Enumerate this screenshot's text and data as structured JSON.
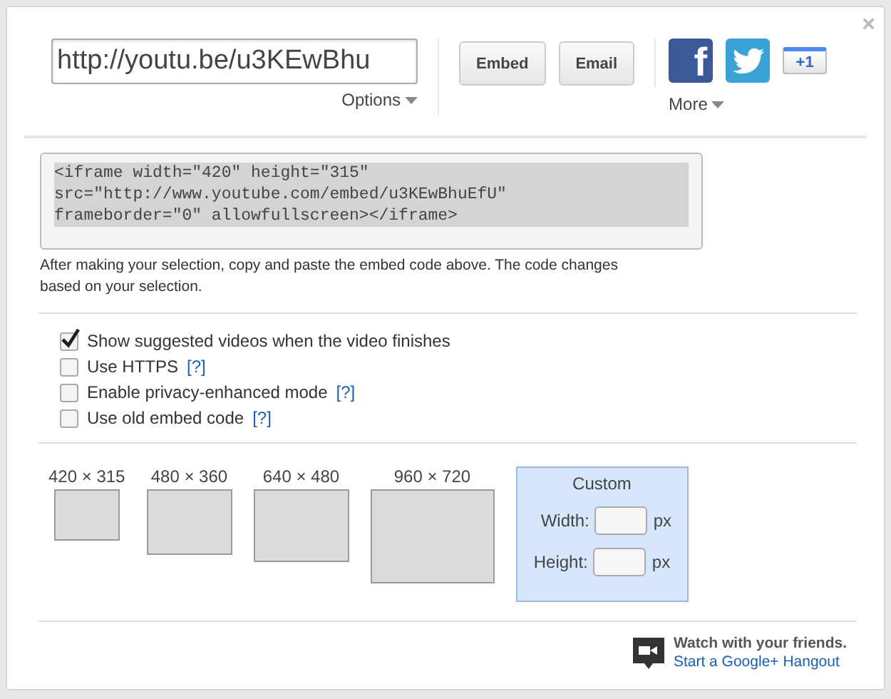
{
  "share": {
    "url": "http://youtu.be/u3KEwBhu",
    "options_label": "Options",
    "buttons": [
      {
        "label": "Embed"
      },
      {
        "label": "Email"
      }
    ],
    "social": [
      {
        "kind": "facebook",
        "label": "f"
      },
      {
        "kind": "twitter"
      },
      {
        "kind": "plusone",
        "label": "+1"
      }
    ],
    "more_label": "More",
    "close": "×"
  },
  "embed": {
    "code": "<iframe width=\"420\" height=\"315\"\nsrc=\"http://www.youtube.com/embed/u3KEwBhuEfU\"\nframeborder=\"0\" allowfullscreen></iframe>",
    "help": "After making your selection, copy and paste the embed code above. The code changes based on your selection."
  },
  "options": [
    {
      "label": "Show suggested videos when the video finishes",
      "checked": true
    },
    {
      "label": "Use HTTPS",
      "help_link": "[?]",
      "checked": false
    },
    {
      "label": "Enable privacy-enhanced mode",
      "help_link": "[?]",
      "checked": false
    },
    {
      "label": "Use old embed code",
      "help_link": "[?]",
      "checked": false
    }
  ],
  "sizes": [
    {
      "kind": "preset",
      "label": "420 × 315",
      "selected": false
    },
    {
      "kind": "preset",
      "label": "480 × 360",
      "selected": false
    },
    {
      "kind": "preset",
      "label": "640 × 480",
      "selected": false
    },
    {
      "kind": "preset",
      "label": "960 × 720",
      "selected": false
    },
    {
      "kind": "custom",
      "label": "Custom",
      "selected": true,
      "fields": [
        {
          "label": "Width:",
          "unit": "px"
        },
        {
          "label": "Height:",
          "unit": "px"
        }
      ]
    }
  ],
  "footer": {
    "title": "Watch with your friends.",
    "link": "Start a Google+ Hangout"
  }
}
